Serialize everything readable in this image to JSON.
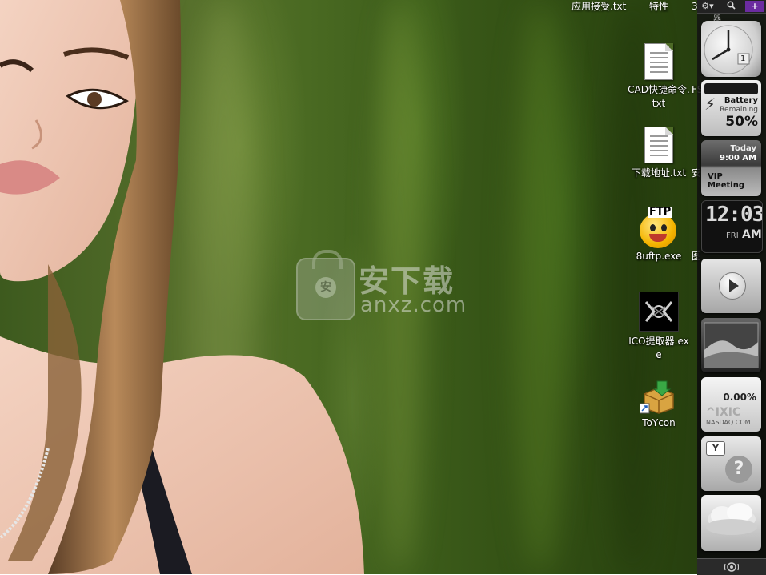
{
  "desktop": {
    "top_labels": [
      "应用接受.txt",
      "特性",
      "3"
    ],
    "icons": [
      {
        "label": "CAD快捷命令.txt",
        "icon": "text-file-icon"
      },
      {
        "label": "下载地址.txt",
        "icon": "text-file-icon"
      },
      {
        "label": "8uftp.exe",
        "icon": "ftp-smiley-icon",
        "badge": "FTP"
      },
      {
        "label": "ICO提取器.exe",
        "icon": "ico-extractor-icon"
      },
      {
        "label": "ToYcon",
        "icon": "package-box-shortcut-icon"
      }
    ],
    "partial_labels": [
      "FS",
      "安",
      "图"
    ],
    "watermark": {
      "logo_char": "安",
      "cn": "安下载",
      "en": "anxz.com"
    }
  },
  "sidebar": {
    "toolbar": {
      "settings_icon": "gear-icon",
      "search_icon": "search-icon",
      "add_label": "+"
    },
    "top_partial": "器",
    "clock": {
      "date": "1"
    },
    "battery": {
      "title": "Battery",
      "subtitle": "Remaining",
      "percent": "50%"
    },
    "calendar": {
      "day": "Today",
      "time": "9:00 AM",
      "event": "VIP Meeting"
    },
    "digital_clock": {
      "time": "12:03",
      "weekday": "FRI",
      "ampm": "AM"
    },
    "stock": {
      "change": "0.00%",
      "symbol": "^IXIC",
      "name": "NASDAQ COM..."
    },
    "feed": {
      "brand": "Y"
    },
    "bottom_icon": "feedback-icon"
  },
  "colors": {
    "accent_purple": "#6b2ba0"
  }
}
